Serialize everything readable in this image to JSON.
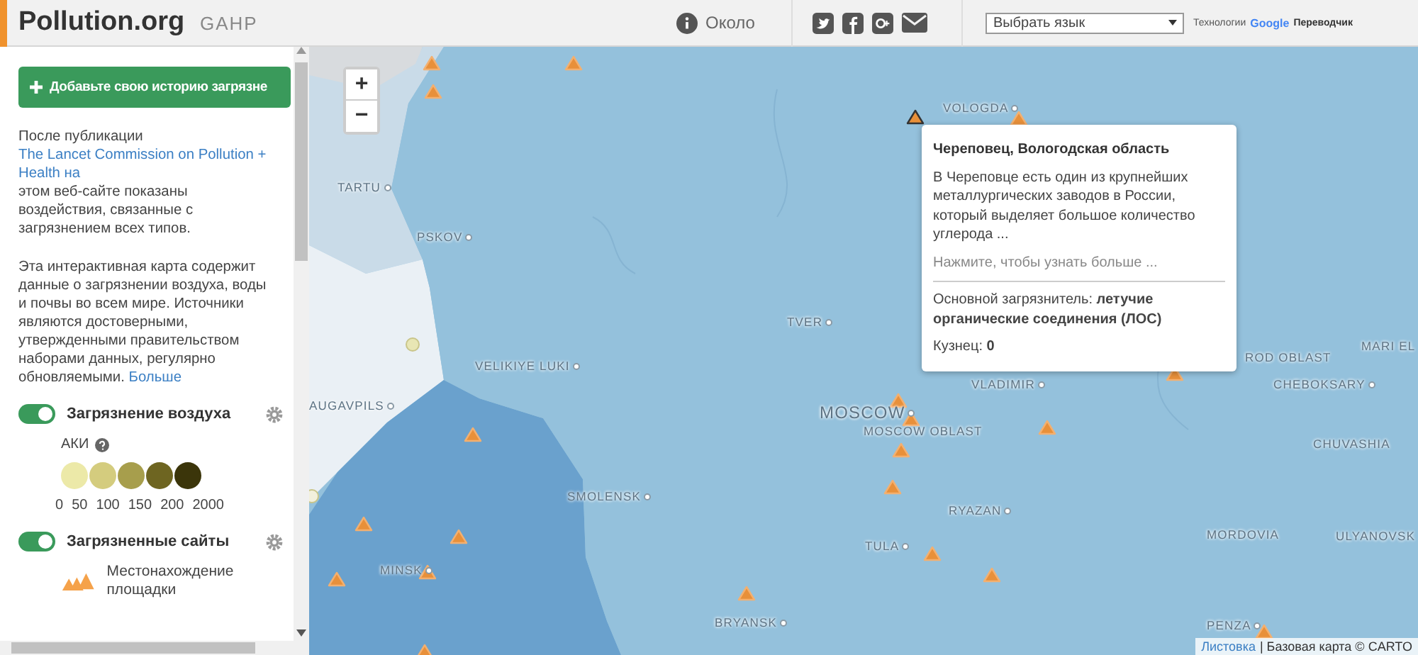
{
  "header": {
    "logo": "Pollution.org",
    "partner_logo": "GAHP",
    "nav": [
      {
        "label": "Около"
      }
    ],
    "language_select": {
      "value": "Выбрать язык"
    },
    "translate": {
      "prefix": "Технологии",
      "brand": "Google",
      "suffix": "Переводчик"
    }
  },
  "sidebar": {
    "add_button": "Добавьте свою историю загрязне",
    "intro": {
      "before": "После публикации ",
      "link": "The Lancet Commission on Pollution + Health на",
      "after": " этом веб-сайте показаны воздействия, связанные с загрязнением всех типов."
    },
    "about": {
      "text": "Эта интерактивная карта содержит данные о загрязнении воздуха, воды и почвы во всем мире. Источники являются достоверными, утвержденными правительством наборами данных, регулярно обновляемыми.",
      "link": "Больше"
    },
    "layers": [
      {
        "kind": "choropleth",
        "title": "Загрязнение воздуха",
        "on": true,
        "legend_title": "АКИ",
        "swatches": [
          {
            "color": "#ece9a8"
          },
          {
            "color": "#d4cc7e"
          },
          {
            "color": "#a79e4c"
          },
          {
            "color": "#6e6521"
          },
          {
            "color": "#3b350a"
          }
        ],
        "ticks": [
          "0",
          "50",
          "100",
          "150",
          "200",
          "2000"
        ]
      },
      {
        "kind": "points",
        "title": "Загрязненные сайты",
        "on": true,
        "legend_label": "Местонахождение площадки"
      }
    ]
  },
  "map": {
    "zoom_in": "+",
    "zoom_out": "−",
    "places": [
      {
        "name": "VOLOGDA",
        "kind": "city"
      },
      {
        "name": "TARTU",
        "kind": "city"
      },
      {
        "name": "PSKOV",
        "kind": "city"
      },
      {
        "name": "TVER",
        "kind": "city"
      },
      {
        "name": "VELIKIYE LUKI",
        "kind": "city"
      },
      {
        "name": "AUGAVPILS",
        "kind": "city"
      },
      {
        "name": "MOSCOW",
        "kind": "capital"
      },
      {
        "name": "MOSCOW OBLAST",
        "kind": "region"
      },
      {
        "name": "VLADIMIR",
        "kind": "city"
      },
      {
        "name": "ROD OBLAST",
        "kind": "region"
      },
      {
        "name": "MARI EL",
        "kind": "region"
      },
      {
        "name": "CHEBOKSARY",
        "kind": "city"
      },
      {
        "name": "CHUVASHIA",
        "kind": "region"
      },
      {
        "name": "SMOLENSK",
        "kind": "city"
      },
      {
        "name": "RYAZAN",
        "kind": "city"
      },
      {
        "name": "TULA",
        "kind": "city"
      },
      {
        "name": "MINSK",
        "kind": "city"
      },
      {
        "name": "MORDOVIA",
        "kind": "region"
      },
      {
        "name": "ULYANOVSK",
        "kind": "city"
      },
      {
        "name": "BRYANSK",
        "kind": "city"
      },
      {
        "name": "PENZA",
        "kind": "city"
      }
    ],
    "popup": {
      "title": "Череповец, Вологодская область",
      "body": "В Череповце есть один из крупнейших металлургических заводов в России, который выделяет большое количество углерода ...",
      "more": "Нажмите, чтобы узнать больше ...",
      "pollutant": "Основной загрязнитель: **летучие органические соединения (ЛОС)**",
      "count": "Кузнец: **0**"
    },
    "attribution": {
      "link": "Листовка",
      "text": "| Базовая карта © CARTO"
    }
  }
}
